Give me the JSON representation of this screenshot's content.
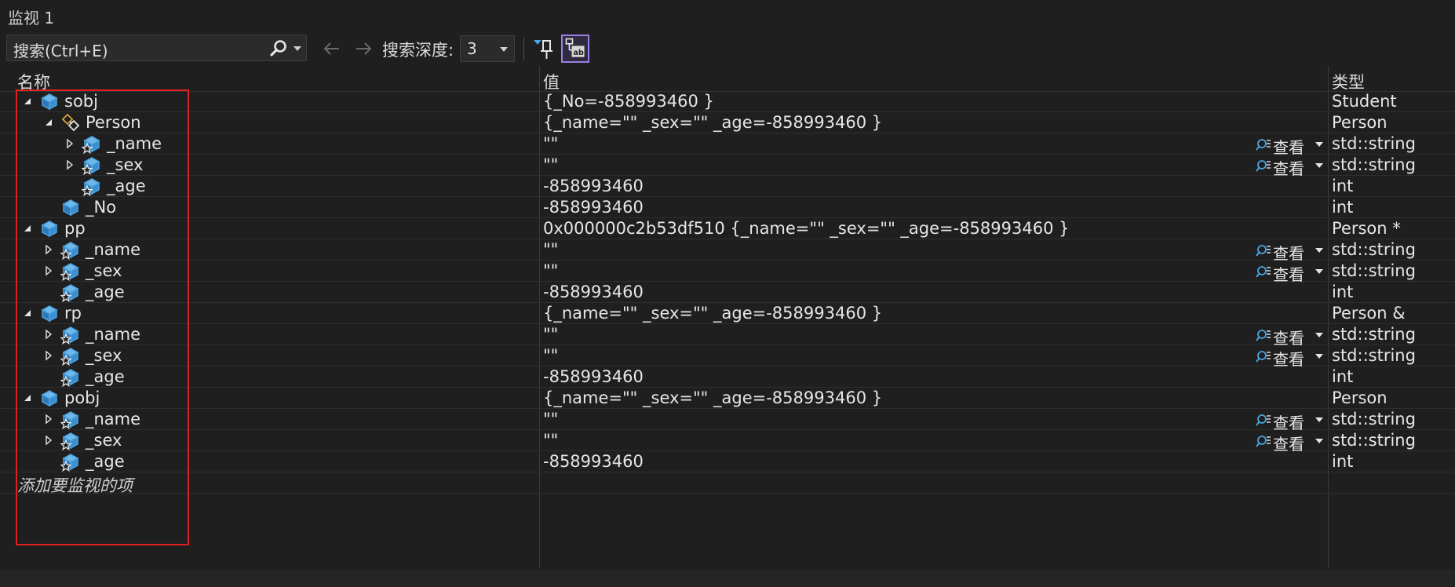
{
  "window": {
    "title": "监视 1"
  },
  "toolbar": {
    "search_placeholder": "搜索(Ctrl+E)",
    "depth_label": "搜索深度:",
    "depth_value": "3"
  },
  "columns": {
    "name": "名称",
    "value": "值",
    "type": "类型"
  },
  "view_label": "查看",
  "rows": [
    {
      "name": "sobj",
      "value": "{_No=-858993460 }",
      "type": "Student",
      "level": 0,
      "expand": "expanded",
      "icon": "object-icon",
      "view": false
    },
    {
      "name": "Person",
      "value": "{_name=\"\" _sex=\"\" _age=-858993460 }",
      "type": "Person",
      "level": 1,
      "expand": "expanded",
      "icon": "base-class-icon",
      "view": false
    },
    {
      "name": "_name",
      "value": "\"\"",
      "type": "std::string",
      "level": 2,
      "expand": "collapsed",
      "icon": "protected-field-icon",
      "view": true
    },
    {
      "name": "_sex",
      "value": "\"\"",
      "type": "std::string",
      "level": 2,
      "expand": "collapsed",
      "icon": "protected-field-icon",
      "view": true
    },
    {
      "name": "_age",
      "value": "-858993460",
      "type": "int",
      "level": 2,
      "expand": "none",
      "icon": "protected-field-icon",
      "view": false
    },
    {
      "name": "_No",
      "value": "-858993460",
      "type": "int",
      "level": 1,
      "expand": "none",
      "icon": "field-icon",
      "view": false
    },
    {
      "name": "pp",
      "value": "0x000000c2b53df510 {_name=\"\" _sex=\"\" _age=-858993460 }",
      "type": "Person *",
      "level": 0,
      "expand": "expanded",
      "icon": "object-icon",
      "view": false
    },
    {
      "name": "_name",
      "value": "\"\"",
      "type": "std::string",
      "level": 1,
      "expand": "collapsed",
      "icon": "protected-field-icon",
      "view": true
    },
    {
      "name": "_sex",
      "value": "\"\"",
      "type": "std::string",
      "level": 1,
      "expand": "collapsed",
      "icon": "protected-field-icon",
      "view": true
    },
    {
      "name": "_age",
      "value": "-858993460",
      "type": "int",
      "level": 1,
      "expand": "none",
      "icon": "protected-field-icon",
      "view": false
    },
    {
      "name": "rp",
      "value": "{_name=\"\" _sex=\"\" _age=-858993460 }",
      "type": "Person &",
      "level": 0,
      "expand": "expanded",
      "icon": "object-icon",
      "view": false
    },
    {
      "name": "_name",
      "value": "\"\"",
      "type": "std::string",
      "level": 1,
      "expand": "collapsed",
      "icon": "protected-field-icon",
      "view": true
    },
    {
      "name": "_sex",
      "value": "\"\"",
      "type": "std::string",
      "level": 1,
      "expand": "collapsed",
      "icon": "protected-field-icon",
      "view": true
    },
    {
      "name": "_age",
      "value": "-858993460",
      "type": "int",
      "level": 1,
      "expand": "none",
      "icon": "protected-field-icon",
      "view": false
    },
    {
      "name": "pobj",
      "value": "{_name=\"\" _sex=\"\" _age=-858993460 }",
      "type": "Person",
      "level": 0,
      "expand": "expanded",
      "icon": "object-icon",
      "view": false
    },
    {
      "name": "_name",
      "value": "\"\"",
      "type": "std::string",
      "level": 1,
      "expand": "collapsed",
      "icon": "protected-field-icon",
      "view": true
    },
    {
      "name": "_sex",
      "value": "\"\"",
      "type": "std::string",
      "level": 1,
      "expand": "collapsed",
      "icon": "protected-field-icon",
      "view": true
    },
    {
      "name": "_age",
      "value": "-858993460",
      "type": "int",
      "level": 1,
      "expand": "none",
      "icon": "protected-field-icon",
      "view": false
    }
  ],
  "add_item_label": "添加要监视的项",
  "colors": {
    "background": "#1f1f1f",
    "icon_blue": "#4aa3df",
    "highlight_box": "#e02020",
    "toggle_accent": "#9b7fe6"
  }
}
